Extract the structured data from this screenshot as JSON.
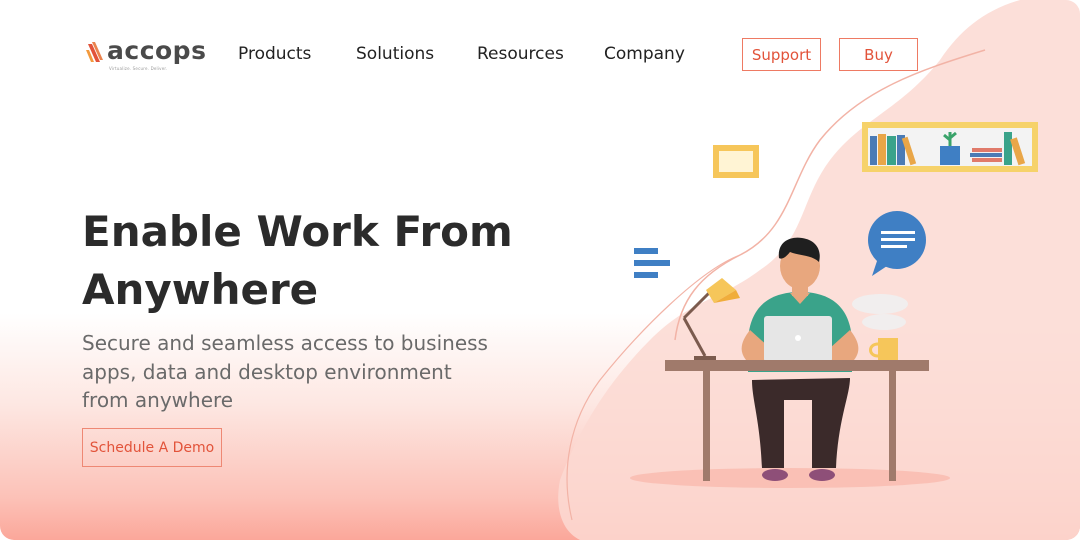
{
  "brand": {
    "name": "accops",
    "tagline": "Virtualize. Secure. Deliver.",
    "accent_color": "#e2533a",
    "logo_icon": "accops-logo-icon"
  },
  "nav": {
    "items": [
      {
        "label": "Products"
      },
      {
        "label": "Solutions"
      },
      {
        "label": "Resources"
      },
      {
        "label": "Company"
      }
    ],
    "support_label": "Support",
    "buy_label": "Buy"
  },
  "hero": {
    "title_line1": "Enable Work From",
    "title_line2": "Anywhere",
    "subtitle_line1": "Secure and seamless access to business",
    "subtitle_line2": "apps, data and desktop environment",
    "subtitle_line3": "from anywhere",
    "cta_label": "Schedule A Demo"
  },
  "illustration": {
    "icons": [
      "picture-frame-icon",
      "bookshelf-icon",
      "chat-bubble-icon",
      "desk-lamp-icon",
      "laptop-icon",
      "coffee-mug-icon",
      "person-at-desk-icon",
      "text-lines-icon"
    ]
  }
}
